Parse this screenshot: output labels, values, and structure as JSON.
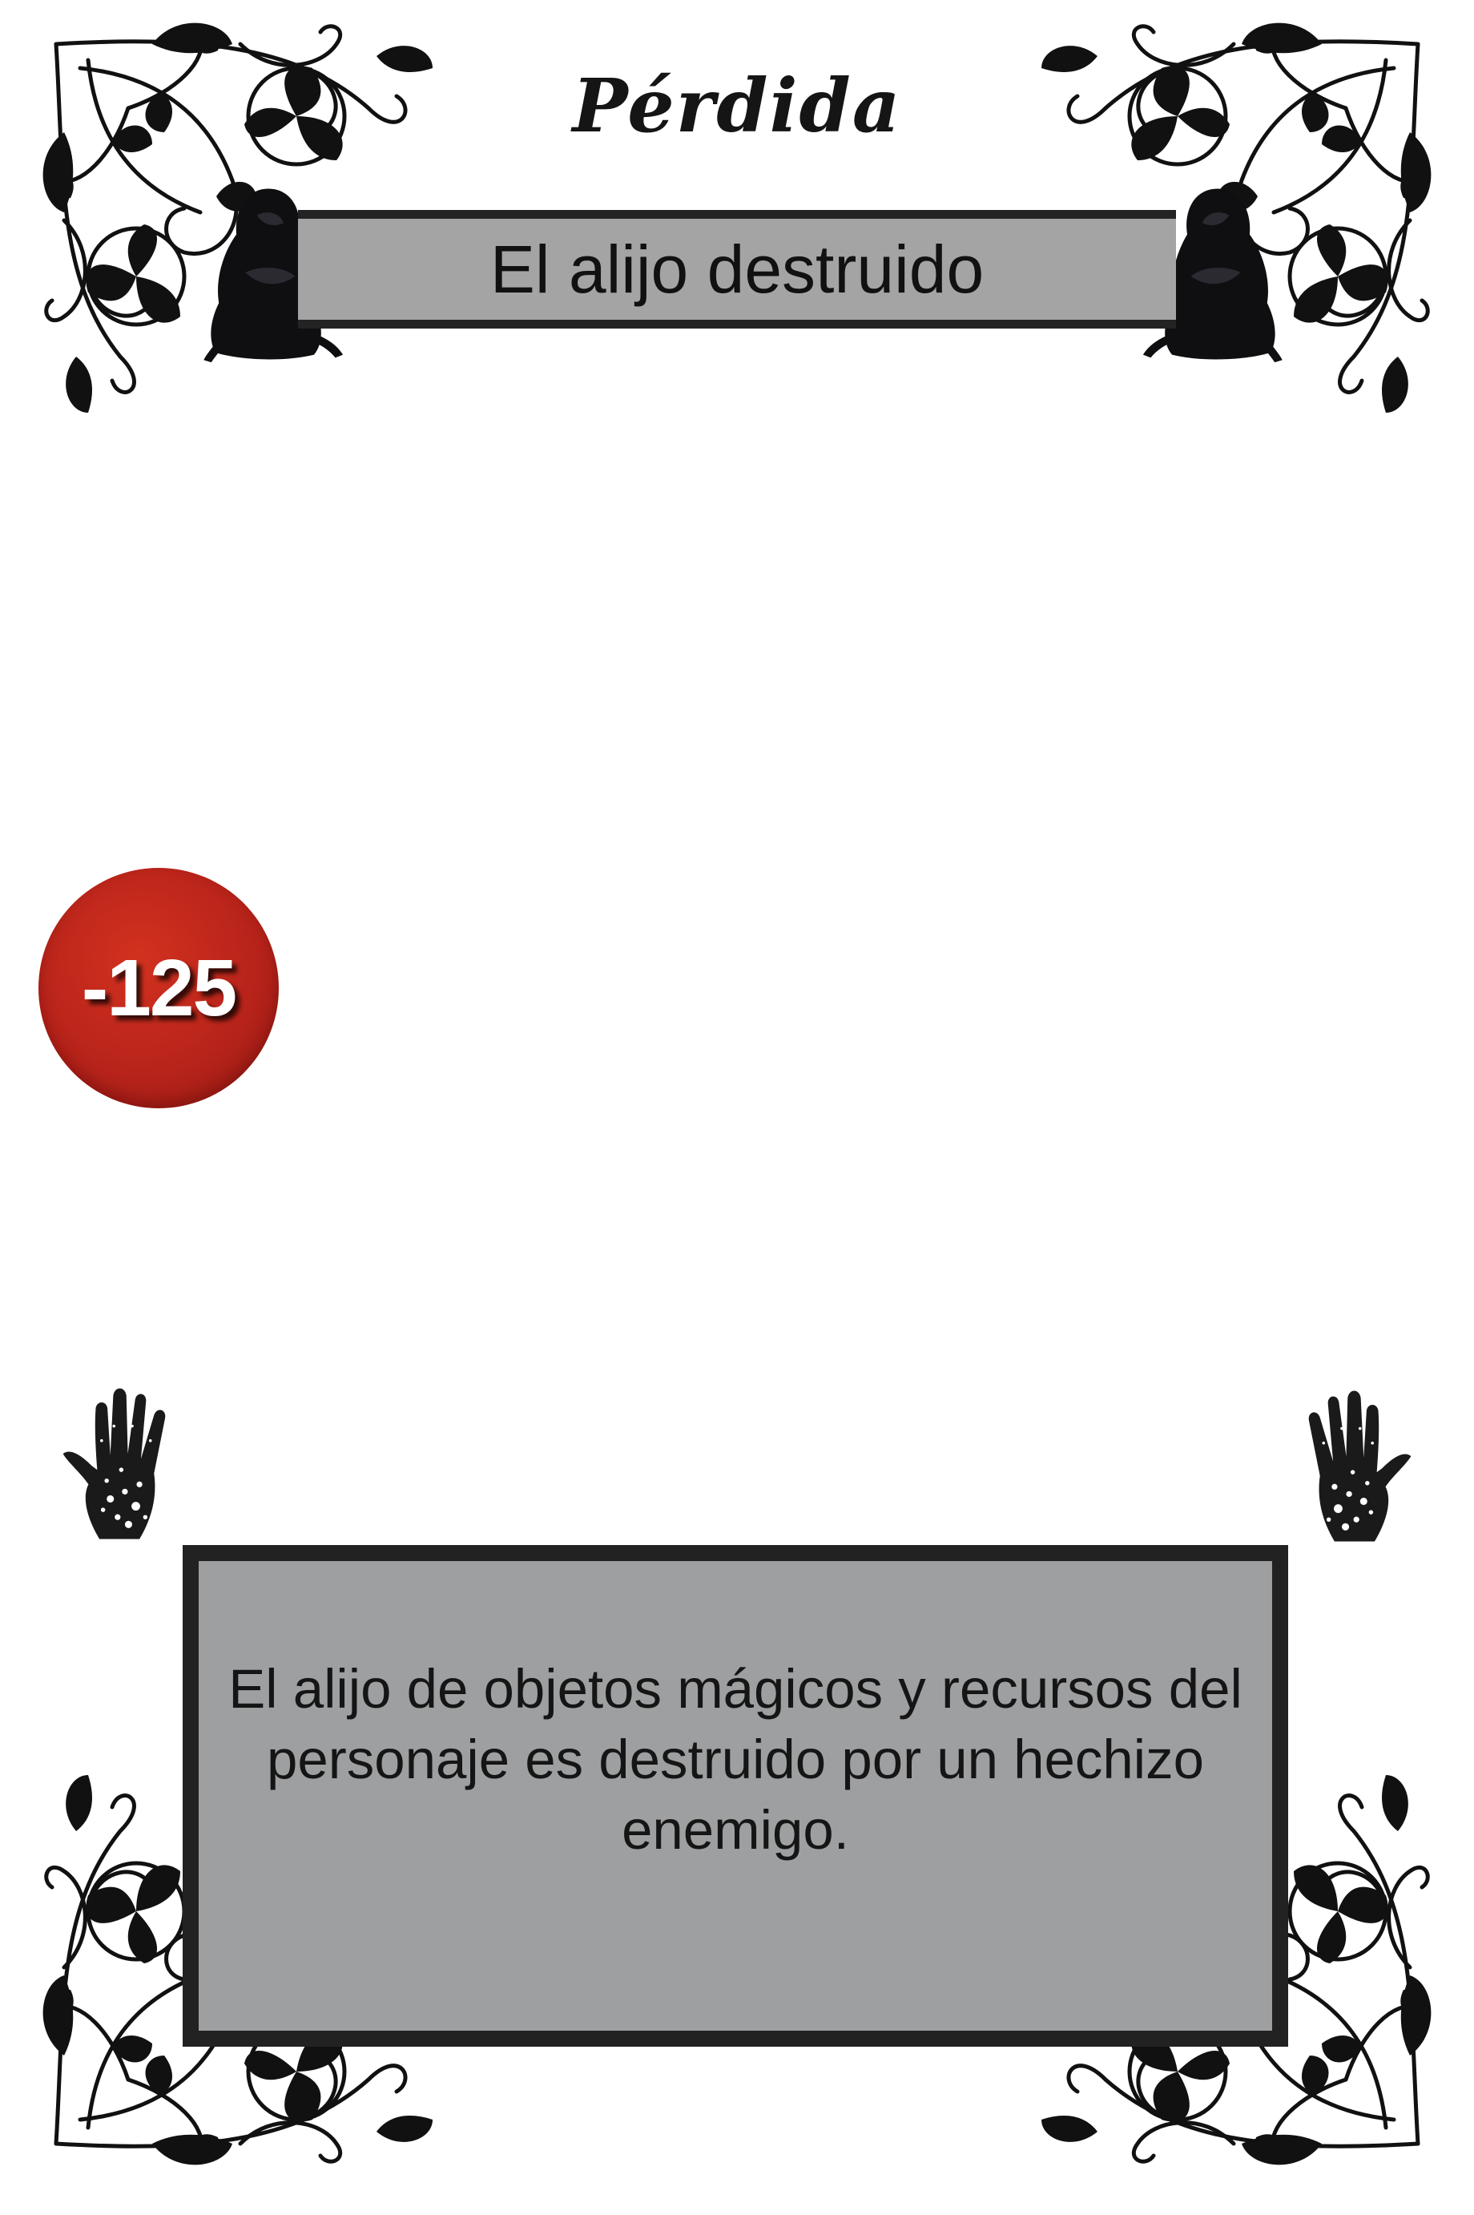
{
  "card": {
    "category": "Pérdida",
    "title": "El alijo destruido",
    "cost": "-125",
    "description": "El alijo de objetos mágicos y recursos del personaje es destruido por un hechizo enemigo."
  },
  "colors": {
    "title_bar": "#a4a4a4",
    "description_box": "#9e9fa0",
    "border": "#222222",
    "cost_badge": "#b7231a",
    "ornament": "#111111"
  },
  "icons": {
    "corner_ornament": "floral-vine-icon",
    "hooded_figure": "hooded-figure-icon",
    "hand": "handprint-icon"
  }
}
